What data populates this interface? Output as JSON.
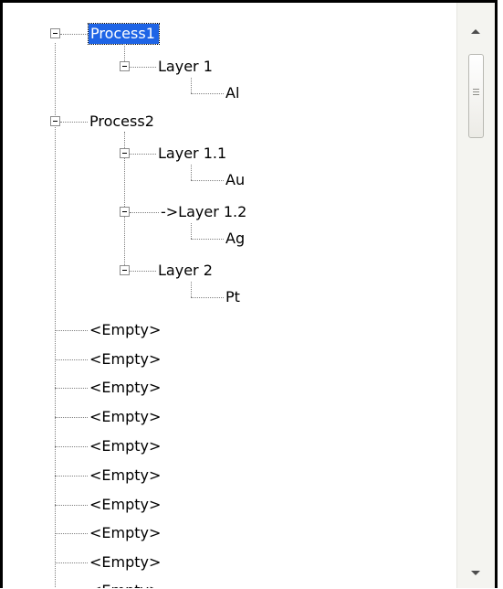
{
  "tree": {
    "processes": [
      {
        "label": "Process1",
        "selected": true,
        "layers": [
          {
            "label": "Layer 1",
            "material": "Al"
          }
        ]
      },
      {
        "label": "Process2",
        "selected": false,
        "layers": [
          {
            "label": "Layer 1.1",
            "material": "Au"
          },
          {
            "label": "->Layer 1.2",
            "material": "Ag"
          },
          {
            "label": "Layer 2",
            "material": "Pt"
          }
        ]
      }
    ],
    "empty_items": [
      "<Empty>",
      "<Empty>",
      "<Empty>",
      "<Empty>",
      "<Empty>",
      "<Empty>",
      "<Empty>",
      "<Empty>",
      "<Empty>",
      "<Empty>"
    ]
  },
  "colors": {
    "selection_background": "#1e64e6",
    "selection_text": "#ffffff"
  },
  "icons": {
    "expand_toggle": "minus-box-icon",
    "scroll_up": "arrow-up-icon",
    "scroll_down": "arrow-down-icon"
  }
}
